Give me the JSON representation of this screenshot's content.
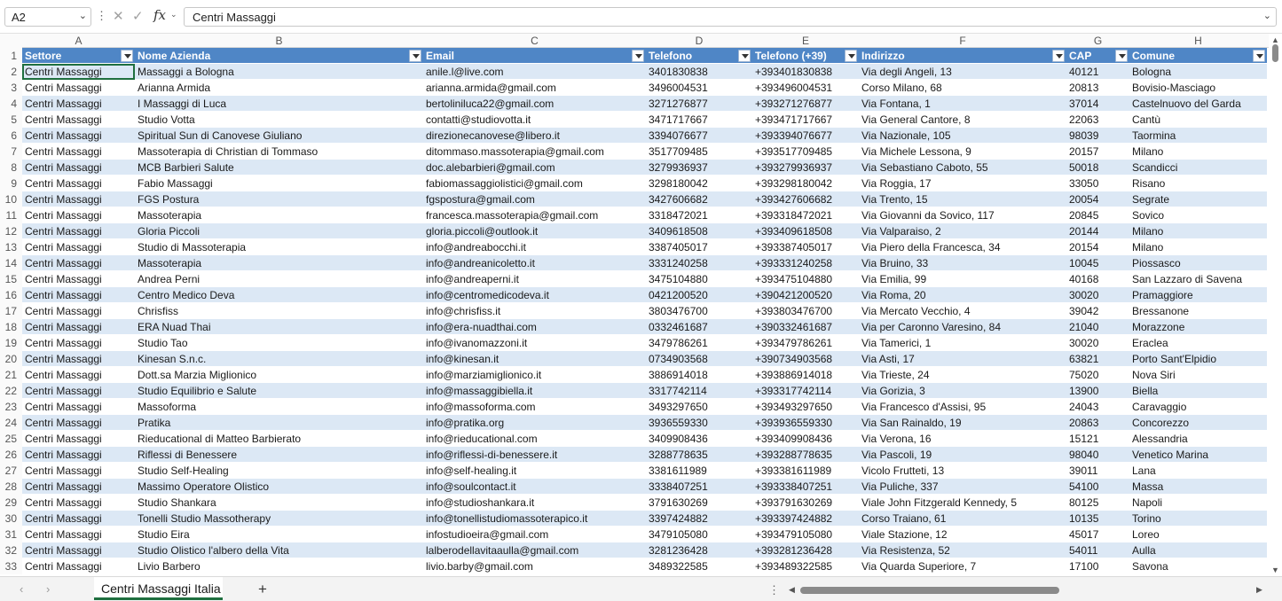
{
  "formula_bar": {
    "name_box": "A2",
    "fx_label": "fx",
    "formula": "Centri Massaggi"
  },
  "columns": [
    "A",
    "B",
    "C",
    "D",
    "E",
    "F",
    "G",
    "H"
  ],
  "table_headers": [
    "Settore",
    "Nome Azienda",
    "Email",
    "Telefono",
    "Telefono (+39)",
    "Indirizzo",
    "CAP",
    "Comune"
  ],
  "header_row_number": "1",
  "rows": [
    {
      "n": "2",
      "cells": [
        "Centri Massaggi",
        "Massaggi a Bologna",
        "anile.l@live.com",
        "3401830838",
        "+393401830838",
        "Via degli Angeli, 13",
        "40121",
        "Bologna"
      ]
    },
    {
      "n": "3",
      "cells": [
        "Centri Massaggi",
        "Arianna Armida",
        "arianna.armida@gmail.com",
        "3496004531",
        "+393496004531",
        "Corso Milano, 68",
        "20813",
        "Bovisio-Masciago"
      ]
    },
    {
      "n": "4",
      "cells": [
        "Centri Massaggi",
        "I Massaggi di Luca",
        "bertoliniluca22@gmail.com",
        "3271276877",
        "+393271276877",
        "Via Fontana, 1",
        "37014",
        "Castelnuovo del Garda"
      ]
    },
    {
      "n": "5",
      "cells": [
        "Centri Massaggi",
        "Studio Votta",
        "contatti@studiovotta.it",
        "3471717667",
        "+393471717667",
        "Via General Cantore, 8",
        "22063",
        "Cantù"
      ]
    },
    {
      "n": "6",
      "cells": [
        "Centri Massaggi",
        "Spiritual Sun di Canovese Giuliano",
        "direzionecanovese@libero.it",
        "3394076677",
        "+393394076677",
        "Via Nazionale, 105",
        "98039",
        "Taormina"
      ]
    },
    {
      "n": "7",
      "cells": [
        "Centri Massaggi",
        "Massoterapia di Christian di Tommaso",
        "ditommaso.massoterapia@gmail.com",
        "3517709485",
        "+393517709485",
        "Via Michele Lessona, 9",
        "20157",
        "Milano"
      ]
    },
    {
      "n": "8",
      "cells": [
        "Centri Massaggi",
        "MCB Barbieri Salute",
        "doc.alebarbieri@gmail.com",
        "3279936937",
        "+393279936937",
        "Via Sebastiano Caboto, 55",
        "50018",
        "Scandicci"
      ]
    },
    {
      "n": "9",
      "cells": [
        "Centri Massaggi",
        "Fabio Massaggi",
        "fabiomassaggiolistici@gmail.com",
        "3298180042",
        "+393298180042",
        "Via Roggia, 17",
        "33050",
        "Risano"
      ]
    },
    {
      "n": "10",
      "cells": [
        "Centri Massaggi",
        "FGS Postura",
        "fgspostura@gmail.com",
        "3427606682",
        "+393427606682",
        "Via Trento, 15",
        "20054",
        "Segrate"
      ]
    },
    {
      "n": "11",
      "cells": [
        "Centri Massaggi",
        "Massoterapia",
        "francesca.massoterapia@gmail.com",
        "3318472021",
        "+393318472021",
        "Via Giovanni da Sovico, 117",
        "20845",
        "Sovico"
      ]
    },
    {
      "n": "12",
      "cells": [
        "Centri Massaggi",
        "Gloria Piccoli",
        "gloria.piccoli@outlook.it",
        "3409618508",
        "+393409618508",
        "Via Valparaiso, 2",
        "20144",
        "Milano"
      ]
    },
    {
      "n": "13",
      "cells": [
        "Centri Massaggi",
        "Studio di Massoterapia",
        "info@andreabocchi.it",
        "3387405017",
        "+393387405017",
        "Via Piero della Francesca, 34",
        "20154",
        "Milano"
      ]
    },
    {
      "n": "14",
      "cells": [
        "Centri Massaggi",
        "Massoterapia",
        "info@andreanicoletto.it",
        "3331240258",
        "+393331240258",
        "Via Bruino, 33",
        "10045",
        "Piossasco"
      ]
    },
    {
      "n": "15",
      "cells": [
        "Centri Massaggi",
        "Andrea Perni",
        "info@andreaperni.it",
        "3475104880",
        "+393475104880",
        "Via Emilia, 99",
        "40168",
        "San Lazzaro di Savena"
      ]
    },
    {
      "n": "16",
      "cells": [
        "Centri Massaggi",
        "Centro Medico Deva",
        "info@centromedicodeva.it",
        "0421200520",
        "+390421200520",
        "Via Roma, 20",
        "30020",
        "Pramaggiore"
      ]
    },
    {
      "n": "17",
      "cells": [
        "Centri Massaggi",
        "Chrisfiss",
        "info@chrisfiss.it",
        "3803476700",
        "+393803476700",
        "Via Mercato Vecchio, 4",
        "39042",
        "Bressanone"
      ]
    },
    {
      "n": "18",
      "cells": [
        "Centri Massaggi",
        "ERA Nuad Thai",
        "info@era-nuadthai.com",
        "0332461687",
        "+390332461687",
        "Via per Caronno Varesino, 84",
        "21040",
        "Morazzone"
      ]
    },
    {
      "n": "19",
      "cells": [
        "Centri Massaggi",
        "Studio Tao",
        "info@ivanomazzoni.it",
        "3479786261",
        "+393479786261",
        "Via Tamerici, 1",
        "30020",
        "Eraclea"
      ]
    },
    {
      "n": "20",
      "cells": [
        "Centri Massaggi",
        "Kinesan S.n.c.",
        "info@kinesan.it",
        "0734903568",
        "+390734903568",
        "Via Asti, 17",
        "63821",
        "Porto Sant'Elpidio"
      ]
    },
    {
      "n": "21",
      "cells": [
        "Centri Massaggi",
        "Dott.sa Marzia Miglionico",
        "info@marziamiglionico.it",
        "3886914018",
        "+393886914018",
        "Via Trieste, 24",
        "75020",
        "Nova Siri"
      ]
    },
    {
      "n": "22",
      "cells": [
        "Centri Massaggi",
        "Studio Equilibrio e Salute",
        "info@massaggibiella.it",
        "3317742114",
        "+393317742114",
        "Via Gorizia, 3",
        "13900",
        "Biella"
      ]
    },
    {
      "n": "23",
      "cells": [
        "Centri Massaggi",
        "Massoforma",
        "info@massoforma.com",
        "3493297650",
        "+393493297650",
        "Via Francesco d'Assisi, 95",
        "24043",
        "Caravaggio"
      ]
    },
    {
      "n": "24",
      "cells": [
        "Centri Massaggi",
        "Pratika",
        "info@pratika.org",
        "3936559330",
        "+393936559330",
        "Via San Rainaldo, 19",
        "20863",
        "Concorezzo"
      ]
    },
    {
      "n": "25",
      "cells": [
        "Centri Massaggi",
        "Rieducational di Matteo Barbierato",
        "info@rieducational.com",
        "3409908436",
        "+393409908436",
        "Via Verona, 16",
        "15121",
        "Alessandria"
      ]
    },
    {
      "n": "26",
      "cells": [
        "Centri Massaggi",
        "Riflessi di Benessere",
        "info@riflessi-di-benessere.it",
        "3288778635",
        "+393288778635",
        "Via Pascoli, 19",
        "98040",
        "Venetico Marina"
      ]
    },
    {
      "n": "27",
      "cells": [
        "Centri Massaggi",
        "Studio Self-Healing",
        "info@self-healing.it",
        "3381611989",
        "+393381611989",
        "Vicolo Frutteti, 13",
        "39011",
        "Lana"
      ]
    },
    {
      "n": "28",
      "cells": [
        "Centri Massaggi",
        "Massimo Operatore Olistico",
        "info@soulcontact.it",
        "3338407251",
        "+393338407251",
        "Via Puliche, 337",
        "54100",
        "Massa"
      ]
    },
    {
      "n": "29",
      "cells": [
        "Centri Massaggi",
        "Studio Shankara",
        "info@studioshankara.it",
        "3791630269",
        "+393791630269",
        "Viale John Fitzgerald Kennedy, 5",
        "80125",
        "Napoli"
      ]
    },
    {
      "n": "30",
      "cells": [
        "Centri Massaggi",
        "Tonelli Studio Massotherapy",
        "info@tonellistudiomassoterapico.it",
        "3397424882",
        "+393397424882",
        "Corso Traiano, 61",
        "10135",
        "Torino"
      ]
    },
    {
      "n": "31",
      "cells": [
        "Centri Massaggi",
        "Studio Eira",
        "infostudioeira@gmail.com",
        "3479105080",
        "+393479105080",
        "Viale Stazione, 12",
        "45017",
        "Loreo"
      ]
    },
    {
      "n": "32",
      "cells": [
        "Centri Massaggi",
        "Studio Olistico l'albero della Vita",
        "lalberodellavitaaulla@gmail.com",
        "3281236428",
        "+393281236428",
        "Via Resistenza, 52",
        "54011",
        "Aulla"
      ]
    },
    {
      "n": "33",
      "cells": [
        "Centri Massaggi",
        "Livio Barbero",
        "livio.barby@gmail.com",
        "3489322585",
        "+393489322585",
        "Via Quarda Superiore, 7",
        "17100",
        "Savona"
      ]
    }
  ],
  "sheet_tab": "Centri Massaggi Italia",
  "colors": {
    "header_fill": "#4f86c6",
    "band_fill": "#dce8f5",
    "active_tab_underline": "#1f6f3f"
  },
  "icons": {
    "name_box_dropdown": "chevron-down-icon",
    "cancel": "close-icon",
    "enter": "check-icon",
    "function": "fx-icon",
    "expand": "chevron-down-icon",
    "add_sheet": "plus-icon",
    "sheet_prev": "chevron-left-icon",
    "sheet_next": "chevron-right-icon"
  }
}
